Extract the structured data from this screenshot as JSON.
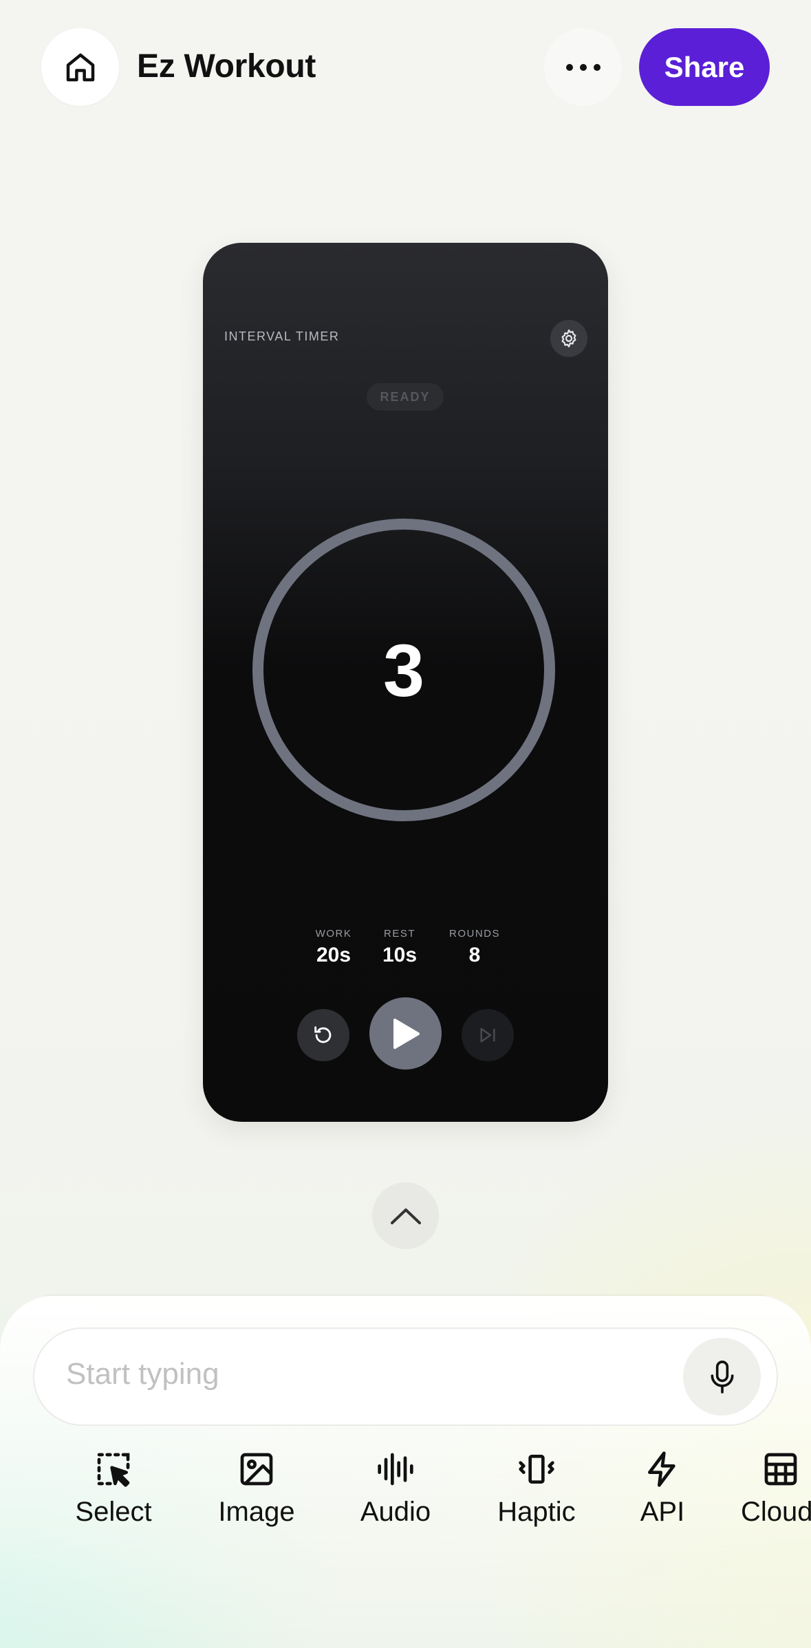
{
  "header": {
    "app_title": "Ez Workout",
    "share_label": "Share",
    "home_icon": "home-icon",
    "more_icon": "more-horizontal-icon"
  },
  "preview": {
    "label": "INTERVAL TIMER",
    "status": "READY",
    "countdown": "3",
    "stats": [
      {
        "label": "WORK",
        "value": "20s"
      },
      {
        "label": "REST",
        "value": "10s"
      },
      {
        "label": "ROUNDS",
        "value": "8"
      }
    ],
    "controls": [
      "reset-icon",
      "play-icon",
      "skip-next-icon"
    ]
  },
  "composer": {
    "placeholder": "Start typing",
    "tools": [
      {
        "label": "Select",
        "icon": "select-icon"
      },
      {
        "label": "Image",
        "icon": "image-icon"
      },
      {
        "label": "Audio",
        "icon": "audio-icon"
      },
      {
        "label": "Haptic",
        "icon": "haptic-icon"
      },
      {
        "label": "API",
        "icon": "api-icon"
      },
      {
        "label": "Cloud",
        "icon": "cloud-icon"
      }
    ]
  },
  "colors": {
    "accent": "#5a1fd6",
    "phone_bg": "#0b0b0c",
    "ring": "#6f7380"
  }
}
